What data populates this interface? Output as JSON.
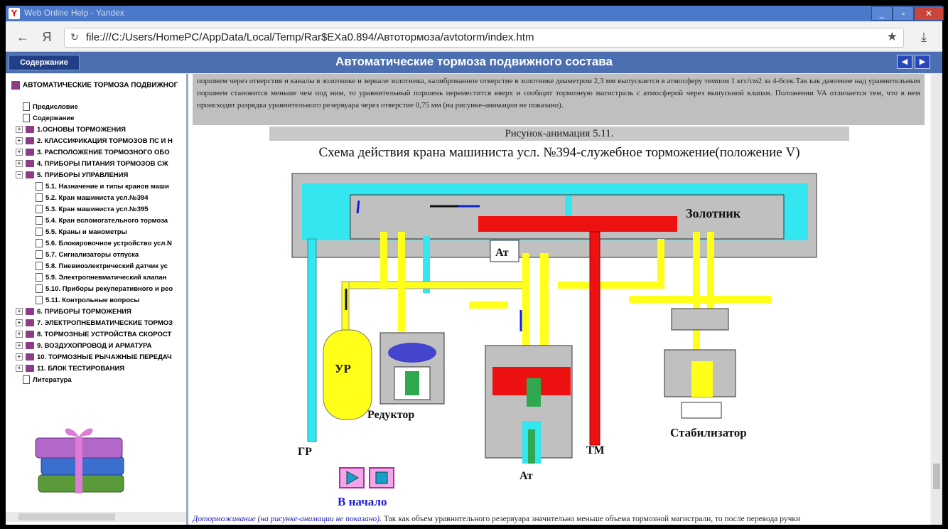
{
  "browser": {
    "window_title": "Web Online Help - Yandex",
    "url": "file:///C:/Users/HomePC/AppData/Local/Temp/Rar$EXa0.894/Автотормоза/avtotorm/index.htm"
  },
  "header": {
    "toc_button": "Содержание",
    "title": "Автоматические тормоза подвижного состава"
  },
  "sidebar": {
    "root": "АВТОМАТИЧЕСКИЕ ТОРМОЗА ПОДВИЖНОГ",
    "items": [
      {
        "label": "Предисловие",
        "kind": "page",
        "level": 0
      },
      {
        "label": "Содержание",
        "kind": "page",
        "level": 0
      },
      {
        "label": "1.ОСНОВЫ ТОРМОЖЕНИЯ",
        "kind": "book",
        "level": 0
      },
      {
        "label": "2. КЛАССИФИКАЦИЯ ТОРМОЗОВ ПС И Н",
        "kind": "book",
        "level": 0
      },
      {
        "label": "3. РАСПОЛОЖЕНИЕ ТОРМОЗНОГО ОБО",
        "kind": "book",
        "level": 0
      },
      {
        "label": "4. ПРИБОРЫ ПИТАНИЯ ТОРМОЗОВ СЖ",
        "kind": "book",
        "level": 0
      },
      {
        "label": "5. ПРИБОРЫ УПРАВЛЕНИЯ",
        "kind": "open",
        "level": 0
      },
      {
        "label": "5.1. Назначение и типы кранов маши",
        "kind": "page",
        "level": 1
      },
      {
        "label": "5.2. Кран машиниста усл.№394",
        "kind": "page",
        "level": 1
      },
      {
        "label": "5.3. Кран машиниста усл.№395",
        "kind": "page",
        "level": 1
      },
      {
        "label": "5.4. Кран вспомогательного тормоза",
        "kind": "page",
        "level": 1
      },
      {
        "label": "5.5. Краны и манометры",
        "kind": "page",
        "level": 1
      },
      {
        "label": "5.6. Блокировочное устройство усл.N",
        "kind": "page",
        "level": 1
      },
      {
        "label": "5.7. Сигнализаторы отпуска",
        "kind": "page",
        "level": 1
      },
      {
        "label": "5.8. Пневмоэлектрический датчик ус",
        "kind": "page",
        "level": 1
      },
      {
        "label": "5.9. Электропневматический клапан",
        "kind": "page",
        "level": 1
      },
      {
        "label": "5.10. Приборы рекуперативного и рео",
        "kind": "page",
        "level": 1
      },
      {
        "label": "5.11. Контрольные вопросы",
        "kind": "page",
        "level": 1
      },
      {
        "label": "6. ПРИБОРЫ ТОРМОЖЕНИЯ",
        "kind": "book",
        "level": 0
      },
      {
        "label": "7. ЭЛЕКТРОПНЕВМАТИЧЕСКИЕ ТОРМОЗ",
        "kind": "book",
        "level": 0
      },
      {
        "label": "8. ТОРМОЗНЫЕ УСТРОЙСТВА СКОРОСТ",
        "kind": "book",
        "level": 0
      },
      {
        "label": "9. ВОЗДУХОПРОВОД И АРМАТУРА",
        "kind": "book",
        "level": 0
      },
      {
        "label": "10. ТОРМОЗНЫЕ РЫЧАЖНЫЕ ПЕРЕДАЧ",
        "kind": "book",
        "level": 0
      },
      {
        "label": "11. БЛОК ТЕСТИРОВАНИЯ",
        "kind": "book",
        "level": 0
      },
      {
        "label": "Литература",
        "kind": "page",
        "level": -1
      }
    ]
  },
  "content": {
    "top_text": "поршнем через отверстия и каналы в золотнике и зеркале золотника, калиброванное отверстие в золотнике диаметром 2,3 мм выпускается в атмосферу темпом 1 кгс/см2 за 4-6сек.Так как давление над уравнительным поршнем становится меньше чем под ним, то уравнительный поршень переместится вверх и сообщит тормозную магистраль с атмосферой через выпускной клапан. Положении VA отличается тем, что в нем происходит разрядка уравнительного резервуара через отверстие 0,75 мм (на рисунке-анимации не показано).",
    "figure_caption": "Рисунок-анимация 5.11.",
    "diagram_title": "Схема действия крана машиниста усл. №394-служебное торможение(положение V)",
    "labels": {
      "zolotnik": "Золотник",
      "at_top": "Ат",
      "ur": "УР",
      "reduktor": "Редуктор",
      "gr": "ГР",
      "tm": "ТМ",
      "at_bottom": "Ат",
      "stabilizator": "Стабилизатор"
    },
    "begin_link": "В начало",
    "bottom_italic": "Доторможивание (на рисунке-анимации не показано).",
    "bottom_text": " Так как объем уравнительного резервуара значительно меньше объема тормозной магистрали, то после перевода ручки"
  },
  "colors": {
    "cyan": "#33e6f0",
    "yellow": "#ffff1a",
    "red": "#ee1111",
    "gray": "#c0c0c0",
    "green": "#2fa84f",
    "blue_arrow": "#1020e0",
    "header_blue": "#4c6fb1"
  }
}
